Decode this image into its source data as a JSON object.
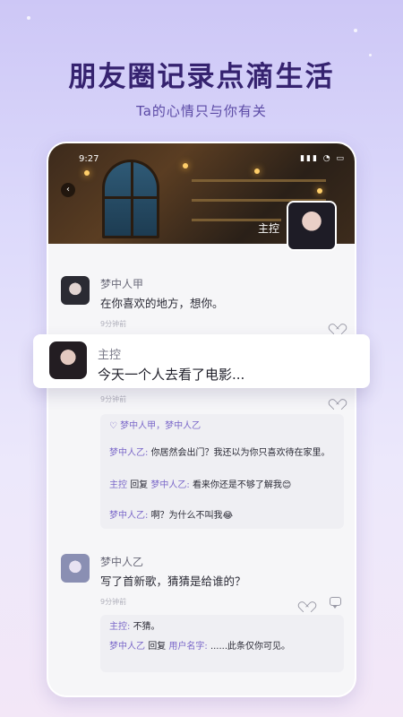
{
  "headline": "朋友圈记录点滴生活",
  "subline": "Ta的心情只与你有关",
  "phone": {
    "status_time": "9:27",
    "status_icons": "▮▮▮ ◔ ▭",
    "cover_name": "主控",
    "back_icon": "‹"
  },
  "posts": [
    {
      "name": "梦中人甲",
      "text": "在你喜欢的地方，想你。",
      "time": "9分钟前"
    },
    {
      "name": "主控",
      "text": "今天一个人去看了电影...",
      "time": "9分钟前",
      "likes": "♡ 梦中人甲，梦中人乙",
      "replies": [
        {
          "author": "梦中人乙:",
          "text": "你居然会出门？我还以为你只喜欢待在家里。"
        },
        {
          "author": "主控",
          "connector": "回复",
          "target": "梦中人乙:",
          "text": "看来你还是不够了解我😊"
        },
        {
          "author": "梦中人乙:",
          "text": "啊？为什么不叫我😂"
        }
      ]
    },
    {
      "name": "梦中人乙",
      "text": "写了首新歌，猜猜是给谁的？",
      "time": "9分钟前",
      "replies": [
        {
          "author": "主控:",
          "text": "不猜。"
        },
        {
          "author": "梦中人乙",
          "connector": "回复",
          "target": "用户名字:",
          "text": "......此条仅你可见。"
        }
      ]
    }
  ]
}
